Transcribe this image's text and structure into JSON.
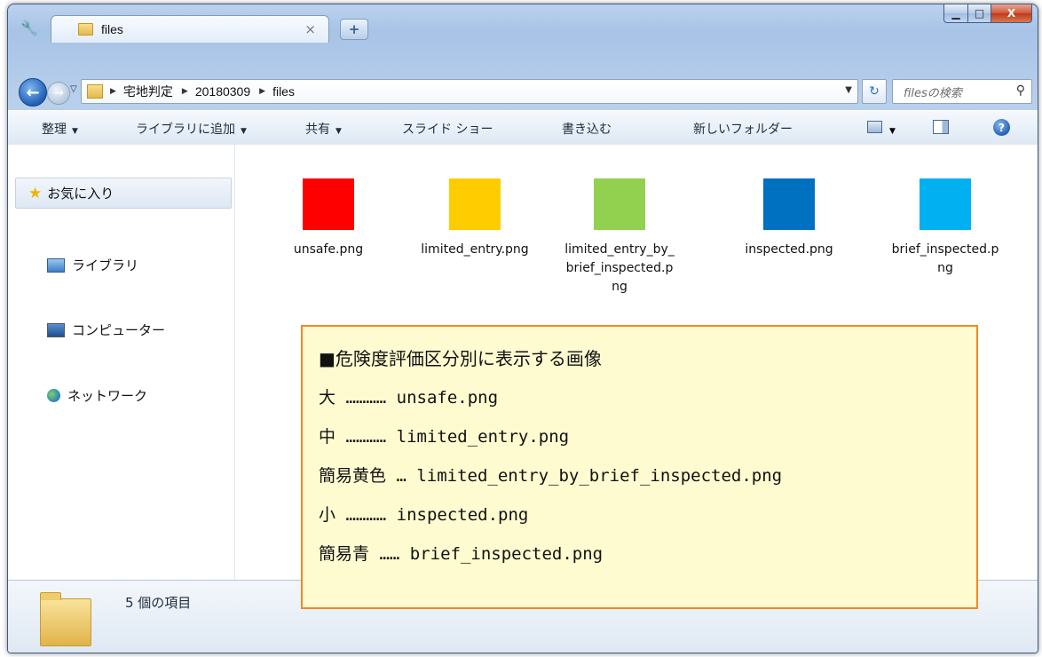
{
  "window": {
    "tab_title": "files",
    "tab_close": "×",
    "new_tab": "+",
    "minimize": "▁",
    "maximize": "□",
    "close": "X"
  },
  "address": {
    "breadcrumbs": [
      "宅地判定",
      "20180309",
      "files"
    ],
    "search_placeholder": "filesの検索"
  },
  "toolbar": {
    "organize": "整理",
    "add_to_library": "ライブラリに追加",
    "share": "共有",
    "slideshow": "スライド ショー",
    "burn": "書き込む",
    "new_folder": "新しいフォルダー",
    "help": "?"
  },
  "navpane": {
    "favorites": "お気に入り",
    "libraries": "ライブラリ",
    "computer": "コンピューター",
    "network": "ネットワーク"
  },
  "files": [
    {
      "name": "unsafe.png",
      "color": "#ff0000"
    },
    {
      "name": "limited_entry.png",
      "color": "#ffcc00"
    },
    {
      "name": "limited_entry_by_brief_inspected.png",
      "color": "#92d050"
    },
    {
      "name": "inspected.png",
      "color": "#0070c0"
    },
    {
      "name": "brief_inspected.png",
      "color": "#00b0f0"
    }
  ],
  "details": {
    "item_count": "5 個の項目"
  },
  "note": {
    "title": "■危険度評価区分別に表示する画像",
    "lines": [
      "大 ………… unsafe.png",
      "中 ………… limited_entry.png",
      "簡易黄色 … limited_entry_by_brief_inspected.png",
      "小 ………… inspected.png",
      "簡易青 …… brief_inspected.png"
    ],
    "border_color": "#f08a24",
    "background": "#fffbd0"
  }
}
